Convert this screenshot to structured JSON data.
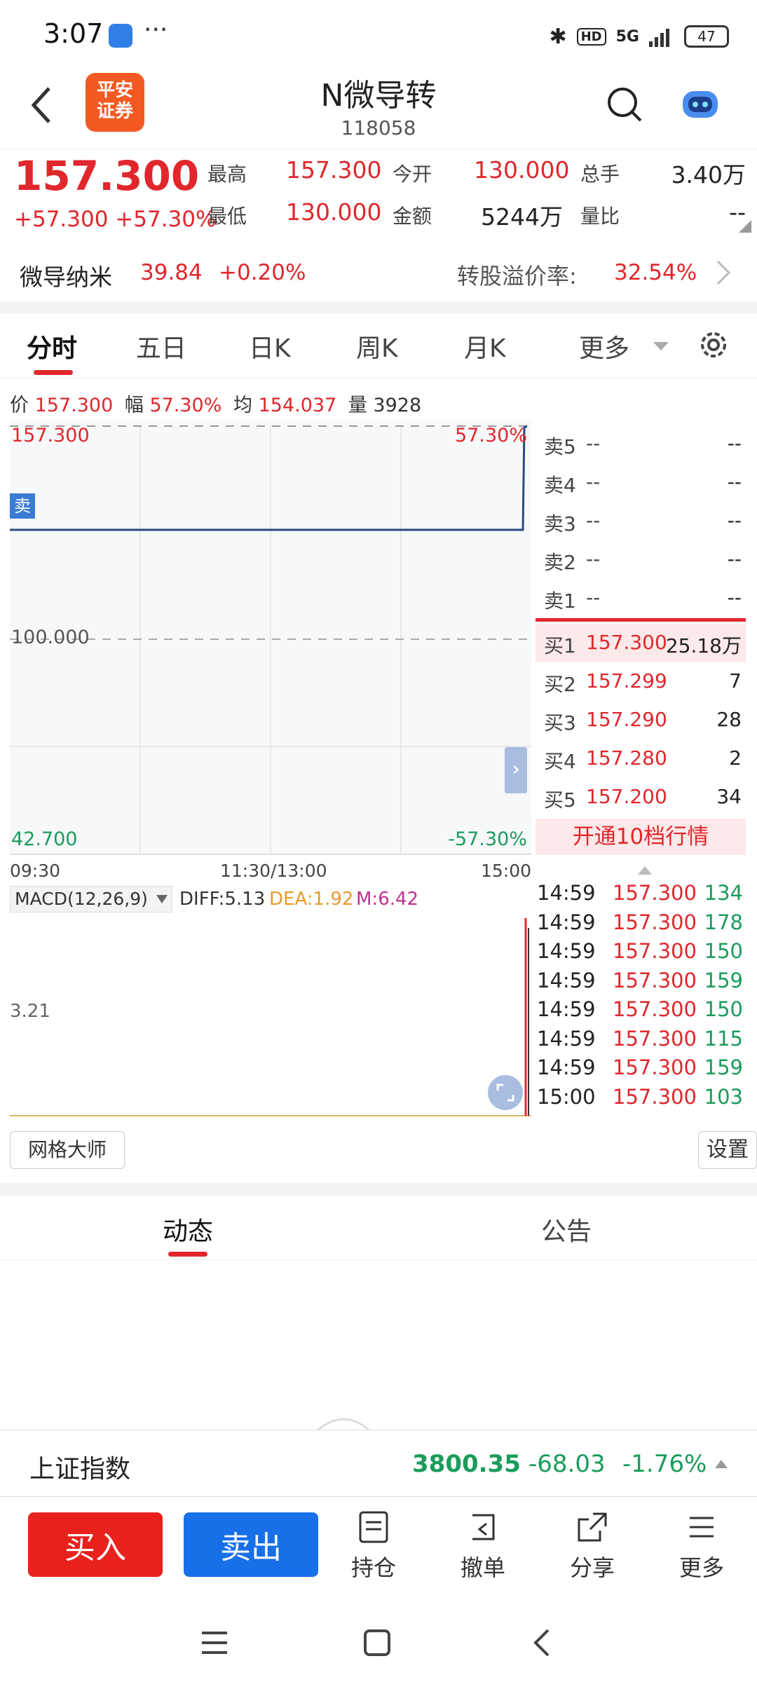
{
  "status_bar": {
    "time": "3:07",
    "dots": "···",
    "hd": "HD",
    "net": "5G",
    "battery": "47"
  },
  "header": {
    "logo_text": "平安证券",
    "title": "N微导转",
    "code": "118058"
  },
  "quote": {
    "price": "157.300",
    "change": "+57.300",
    "change_pct": "+57.30%",
    "labels": {
      "high": "最高",
      "open": "今开",
      "volume": "总手",
      "low": "最低",
      "amount": "金额",
      "ratio": "量比"
    },
    "values": {
      "high": "157.300",
      "open": "130.000",
      "volume": "3.40万",
      "low": "130.000",
      "amount": "5244万",
      "ratio": "--"
    }
  },
  "underlying": {
    "name": "微导纳米",
    "price": "39.84",
    "change": "+0.20%",
    "premium_label": "转股溢价率:",
    "premium_value": "32.54%"
  },
  "tabs": [
    "分时",
    "五日",
    "日K",
    "周K",
    "月K",
    "更多"
  ],
  "infoline": {
    "price_label": "价",
    "price": "157.300",
    "amp_label": "幅",
    "amp": "57.30%",
    "avg_label": "均",
    "avg": "154.037",
    "vol_label": "量",
    "vol": "3928"
  },
  "chart": {
    "top_price": "157.300",
    "top_pct": "57.30%",
    "mid_price": "100.000",
    "bottom_price": "42.700",
    "bottom_pct": "-57.30%",
    "sell_tag": "卖",
    "times": [
      "09:30",
      "11:30/13:00",
      "15:00"
    ]
  },
  "order_book": {
    "asks": [
      {
        "label": "卖5",
        "price": "--",
        "qty": "--"
      },
      {
        "label": "卖4",
        "price": "--",
        "qty": "--"
      },
      {
        "label": "卖3",
        "price": "--",
        "qty": "--"
      },
      {
        "label": "卖2",
        "price": "--",
        "qty": "--"
      },
      {
        "label": "卖1",
        "price": "--",
        "qty": "--"
      }
    ],
    "bids": [
      {
        "label": "买1",
        "price": "157.300",
        "qty": "25.18万"
      },
      {
        "label": "买2",
        "price": "157.299",
        "qty": "7"
      },
      {
        "label": "买3",
        "price": "157.290",
        "qty": "28"
      },
      {
        "label": "买4",
        "price": "157.280",
        "qty": "2"
      },
      {
        "label": "买5",
        "price": "157.200",
        "qty": "34"
      }
    ],
    "promo": "开通10档行情"
  },
  "ticks": [
    {
      "time": "14:59",
      "price": "157.300",
      "vol": "134"
    },
    {
      "time": "14:59",
      "price": "157.300",
      "vol": "178"
    },
    {
      "time": "14:59",
      "price": "157.300",
      "vol": "150"
    },
    {
      "time": "14:59",
      "price": "157.300",
      "vol": "159"
    },
    {
      "time": "14:59",
      "price": "157.300",
      "vol": "150"
    },
    {
      "time": "14:59",
      "price": "157.300",
      "vol": "115"
    },
    {
      "time": "14:59",
      "price": "157.300",
      "vol": "159"
    },
    {
      "time": "15:00",
      "price": "157.300",
      "vol": "103"
    }
  ],
  "macd": {
    "selector": "MACD(12,26,9)",
    "diff": "DIFF:5.13",
    "dea": "DEA:1.92",
    "m": "M:6.42",
    "axis": "3.21"
  },
  "grid_master": "网格大师",
  "settings": "设置",
  "bottom_tabs": [
    "动态",
    "公告"
  ],
  "index": {
    "name": "上证指数",
    "value": "3800.35",
    "change": "-68.03",
    "pct": "-1.76%"
  },
  "toolbar": {
    "buy": "买入",
    "sell": "卖出",
    "position": "持仓",
    "cancel": "撤单",
    "share": "分享",
    "more": "更多"
  },
  "colors": {
    "up": "#e0272c",
    "down": "#1a9c5b",
    "buy_btn": "#e8211d",
    "sell_btn": "#1770e8",
    "line": "#2b4a80"
  }
}
